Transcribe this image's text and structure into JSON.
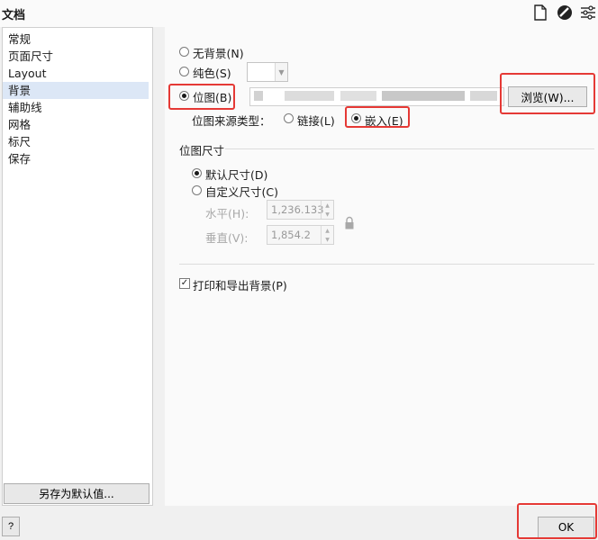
{
  "window": {
    "title": "文档"
  },
  "toolbar_icons": [
    "page-icon",
    "no-entry-icon",
    "settings-sliders-icon"
  ],
  "sidebar": {
    "items": [
      {
        "label": "常规",
        "selected": false
      },
      {
        "label": "页面尺寸",
        "selected": false
      },
      {
        "label": "Layout",
        "selected": false
      },
      {
        "label": "背景",
        "selected": true
      },
      {
        "label": "辅助线",
        "selected": false
      },
      {
        "label": "网格",
        "selected": false
      },
      {
        "label": "标尺",
        "selected": false
      },
      {
        "label": "保存",
        "selected": false
      }
    ],
    "save_default_label": "另存为默认值..."
  },
  "background": {
    "no_background_label": "无背景(N)",
    "solid_color_label": "纯色(S)",
    "bitmap_label": "位图(B)",
    "selected": "bitmap",
    "browse_label": "浏览(W)...",
    "source_type_label": "位图来源类型：",
    "link_label": "链接(L)",
    "embed_label": "嵌入(E)",
    "source_selected": "embed"
  },
  "bitmap_size": {
    "section_label": "位图尺寸",
    "default_size_label": "默认尺寸(D)",
    "custom_size_label": "自定义尺寸(C)",
    "selected": "default",
    "horizontal_label": "水平(H):",
    "horizontal_value": "1,236.133",
    "vertical_label": "垂直(V):",
    "vertical_value": "1,854.2"
  },
  "print_export": {
    "label": "打印和导出背景(P)",
    "checked": true
  },
  "footer": {
    "help_label": "?",
    "ok_label": "OK"
  },
  "colors": {
    "highlight_box": "#e53935",
    "selected_item": "#dce7f6"
  }
}
